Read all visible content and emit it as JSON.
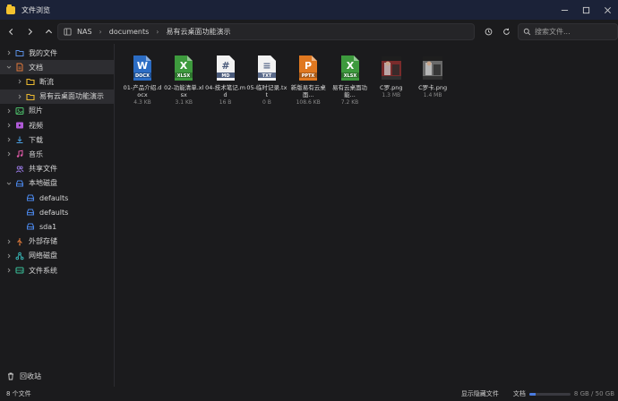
{
  "window": {
    "title": "文件浏览"
  },
  "breadcrumb": [
    "NAS",
    "documents",
    "易有云桌面功能演示"
  ],
  "search": {
    "placeholder": "搜索文件..."
  },
  "sidebar": {
    "items": [
      {
        "label": "我的文件",
        "icon": "folder-outline-icon",
        "color": "#5a8de0",
        "expandable": true
      },
      {
        "label": "文档",
        "icon": "document-icon",
        "color": "#e0783a",
        "expandable": true,
        "expanded": true,
        "active": true
      },
      {
        "label": "断流",
        "icon": "folder-icon",
        "color": "#e8b730",
        "expandable": true,
        "child": true
      },
      {
        "label": "易有云桌面功能演示",
        "icon": "folder-icon",
        "color": "#e8b730",
        "expandable": true,
        "child": true,
        "selected": true
      },
      {
        "label": "照片",
        "icon": "image-icon",
        "color": "#4cbf6a",
        "expandable": true
      },
      {
        "label": "视频",
        "icon": "video-icon",
        "color": "#b05ad8",
        "expandable": true
      },
      {
        "label": "下载",
        "icon": "download-icon",
        "color": "#4a9ee0",
        "expandable": true
      },
      {
        "label": "音乐",
        "icon": "music-icon",
        "color": "#e05aa8",
        "expandable": true
      },
      {
        "label": "共享文件",
        "icon": "users-icon",
        "color": "#9b7be8",
        "expandable": false
      },
      {
        "label": "本地磁盘",
        "icon": "disk-icon",
        "color": "#4a86e8",
        "expandable": true,
        "expanded": true
      },
      {
        "label": "defaults",
        "icon": "disk-icon",
        "color": "#4a86e8",
        "expandable": false,
        "child": true
      },
      {
        "label": "defaults",
        "icon": "disk-icon",
        "color": "#4a86e8",
        "expandable": false,
        "child": true
      },
      {
        "label": "sda1",
        "icon": "disk-icon",
        "color": "#4a86e8",
        "expandable": false,
        "child": true
      },
      {
        "label": "外部存储",
        "icon": "usb-icon",
        "color": "#e07a3a",
        "expandable": true
      },
      {
        "label": "网络磁盘",
        "icon": "network-icon",
        "color": "#3ac0c0",
        "expandable": true
      },
      {
        "label": "文件系统",
        "icon": "hdd-icon",
        "color": "#3ac09a",
        "expandable": true
      }
    ],
    "trash": {
      "label": "回收站",
      "icon": "trash-icon"
    }
  },
  "files": [
    {
      "name": "01-产品介绍.docx",
      "size": "4.3 KB",
      "type": "DOCX",
      "color": "#2b6cc4",
      "letter": "W"
    },
    {
      "name": "02-功能清单.xlsx",
      "size": "3.1 KB",
      "type": "XLSX",
      "color": "#3d9a3d",
      "letter": "X"
    },
    {
      "name": "04-技术笔记.md",
      "size": "16 B",
      "type": "MD",
      "color": "#4a5a7a",
      "letter": "#"
    },
    {
      "name": "05-临时记录.txt",
      "size": "0 B",
      "type": "TXT",
      "color": "#5a6a8a",
      "letter": "≡"
    },
    {
      "name": "新版易有云桌面...",
      "size": "108.6 KB",
      "type": "PPTX",
      "color": "#e07820",
      "letter": "P"
    },
    {
      "name": "易有云桌面功能...",
      "size": "7.2 KB",
      "type": "XLSX",
      "color": "#3d9a3d",
      "letter": "X"
    },
    {
      "name": "C罗.png",
      "size": "1.3 MB",
      "type": "image",
      "color": "#7a2b2b"
    },
    {
      "name": "C罗卡.png",
      "size": "1.4 MB",
      "type": "image",
      "color": "#6a6a6a"
    }
  ],
  "status": {
    "count": "8 个文件",
    "show_hidden": "显示隐藏文件",
    "storage_label": "文档",
    "storage_usage": "8 GB / 50 GB",
    "storage_fraction": 0.16
  }
}
